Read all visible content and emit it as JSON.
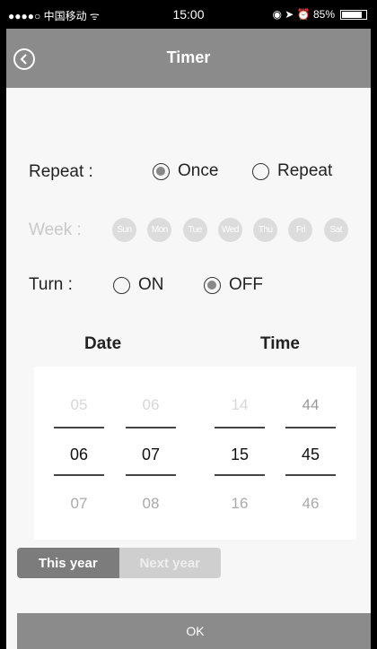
{
  "status_bar": {
    "carrier": "●●●●○ 中国移动 ᯤ",
    "time": "15:00",
    "right": "◉ ➤ ⏰ 85%",
    "battery_level": 0.85
  },
  "header": {
    "title": "Timer",
    "back_icon": "back-circle-icon"
  },
  "repeat": {
    "label": "Repeat :",
    "options": [
      {
        "label": "Once",
        "checked": true
      },
      {
        "label": "Repeat",
        "checked": false
      }
    ]
  },
  "week": {
    "label": "Week :",
    "days": [
      "Sun",
      "Mon",
      "Tue",
      "Wed",
      "Thu",
      "Fri",
      "Sat"
    ]
  },
  "turn": {
    "label": "Turn :",
    "options": [
      {
        "label": "ON",
        "checked": false
      },
      {
        "label": "OFF",
        "checked": true
      }
    ]
  },
  "columns": {
    "date": "Date",
    "time": "Time"
  },
  "picker": {
    "month": {
      "prev": "05",
      "selected": "06",
      "next": "07"
    },
    "day": {
      "prev": "06",
      "selected": "07",
      "next": "08"
    },
    "hour": {
      "prev": "14",
      "selected": "15",
      "next": "16"
    },
    "minute": {
      "prev": "44",
      "selected": "45",
      "next": "46"
    }
  },
  "year_toggle": {
    "this_year": "This year",
    "next_year": "Next year"
  },
  "ok_label": "OK"
}
